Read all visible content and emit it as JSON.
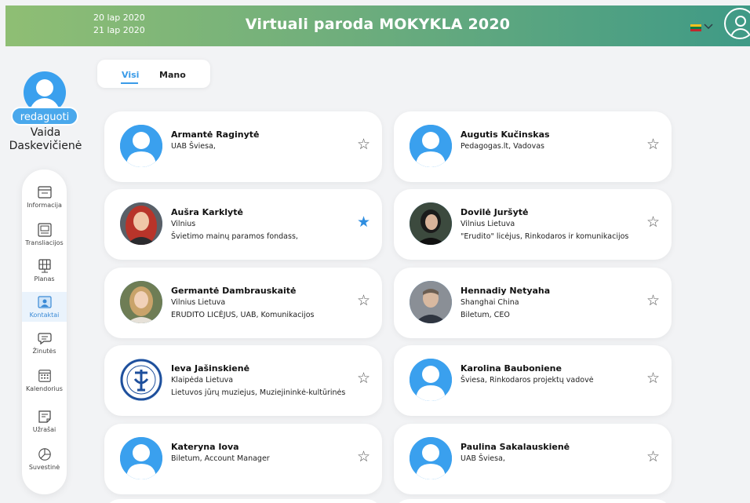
{
  "header": {
    "dates": [
      "20 lap 2020",
      "21 lap 2020"
    ],
    "title": "Virtuali paroda MOKYKLA 2020",
    "flag_colors": [
      "#f7c11e",
      "#0e7a43",
      "#c1272d"
    ],
    "accent": "#3a9be8"
  },
  "profile": {
    "edit_label": "redaguoti",
    "first_name": "Vaida",
    "last_name": "Daskevičienė"
  },
  "nav": {
    "items": [
      {
        "label": "Informacija",
        "icon": "info-window-icon",
        "active": false
      },
      {
        "label": "Transliacijos",
        "icon": "broadcast-icon",
        "active": false
      },
      {
        "label": "Planas",
        "icon": "floor-plan-icon",
        "active": false
      },
      {
        "label": "Kontaktai",
        "icon": "contacts-icon",
        "active": true
      },
      {
        "label": "Žinutės",
        "icon": "messages-icon",
        "active": false
      },
      {
        "label": "Kalendorius",
        "icon": "calendar-icon",
        "active": false
      },
      {
        "label": "Užrašai",
        "icon": "notes-icon",
        "active": false
      },
      {
        "label": "Suvestinė",
        "icon": "summary-chart-icon",
        "active": false
      }
    ]
  },
  "tabs": [
    {
      "label": "Visi",
      "active": true
    },
    {
      "label": "Mano",
      "active": false
    }
  ],
  "contacts": [
    {
      "name": "Armantė Raginytė",
      "lines": [
        "UAB Šviesa,"
      ],
      "favorite": false,
      "avatar": "default"
    },
    {
      "name": "Augutis Kučinskas",
      "lines": [
        "Pedagogas.lt, Vadovas"
      ],
      "favorite": false,
      "avatar": "default"
    },
    {
      "name": "Aušra Karklytė",
      "lines": [
        "Vilnius",
        "Švietimo mainų paramos fondass,"
      ],
      "favorite": true,
      "avatar": "photo-red-hair"
    },
    {
      "name": "Dovilė Juršytė",
      "lines": [
        "Vilnius Lietuva",
        "\"Erudito\" licėjus, Rinkodaros ir komunikacijos"
      ],
      "favorite": false,
      "avatar": "photo-dark"
    },
    {
      "name": "Germantė Dambrauskaitė",
      "lines": [
        "Vilnius Lietuva",
        "ERUDITO LICĖJUS, UAB, Komunikacijos"
      ],
      "favorite": false,
      "avatar": "photo-blonde"
    },
    {
      "name": "Hennadiy Netyaha",
      "lines": [
        "Shanghai China",
        "Biletum, CEO"
      ],
      "favorite": false,
      "avatar": "photo-man"
    },
    {
      "name": "Ieva Jašinskienė",
      "lines": [
        "Klaipėda Lietuva",
        "Lietuvos jūrų muziejus, Muziejininkė-kultūrinės"
      ],
      "favorite": false,
      "avatar": "museum-logo"
    },
    {
      "name": "Karolina Bauboniene",
      "lines": [
        "Šviesa, Rinkodaros projektų vadovė"
      ],
      "favorite": false,
      "avatar": "default"
    },
    {
      "name": "Kateryna Iova",
      "lines": [
        "Biletum, Account Manager"
      ],
      "favorite": false,
      "avatar": "default"
    },
    {
      "name": "Paulina Sakalauskienė",
      "lines": [
        "UAB Šviesa,"
      ],
      "favorite": false,
      "avatar": "default"
    }
  ],
  "star_glyphs": {
    "empty": "☆",
    "filled": "★"
  }
}
